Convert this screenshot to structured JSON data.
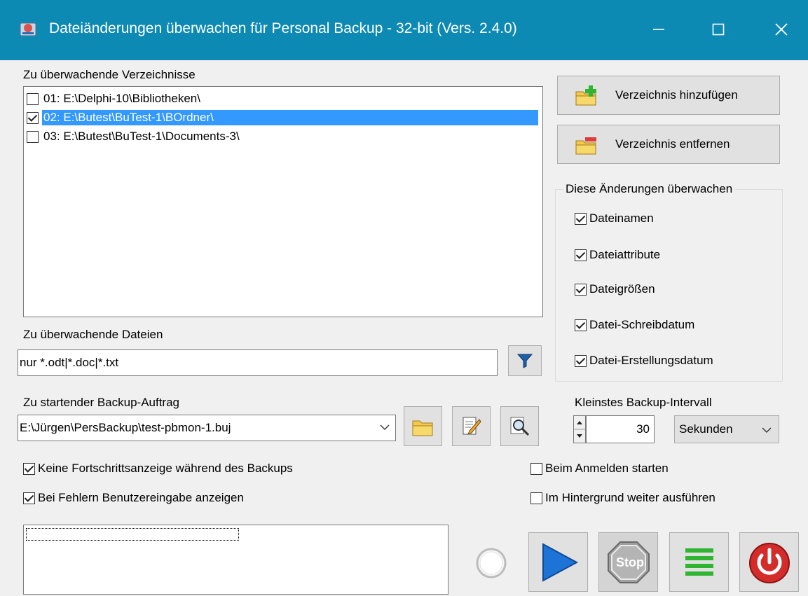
{
  "window": {
    "title": "Dateiänderungen überwachen für Personal Backup - 32-bit (Vers. 2.4.0)",
    "controls": [
      "minimize-icon",
      "maximize-icon",
      "close-icon"
    ]
  },
  "directories": {
    "label": "Zu überwachende Verzeichnisse",
    "items": [
      {
        "text": "01: E:\\Delphi-10\\Bibliotheken\\",
        "checked": false,
        "selected": false
      },
      {
        "text": "02: E:\\Butest\\BuTest-1\\BOrdner\\",
        "checked": true,
        "selected": true
      },
      {
        "text": "03: E:\\Butest\\BuTest-1\\Documents-3\\",
        "checked": false,
        "selected": false
      }
    ],
    "add_button": "Verzeichnis hinzufügen",
    "remove_button": "Verzeichnis entfernen"
  },
  "changes": {
    "title": "Diese Änderungen überwachen",
    "options": [
      {
        "label": "Dateinamen",
        "checked": true
      },
      {
        "label": "Dateiattribute",
        "checked": true
      },
      {
        "label": "Dateigrößen",
        "checked": true
      },
      {
        "label": "Datei-Schreibdatum",
        "checked": true
      },
      {
        "label": "Datei-Erstellungsdatum",
        "checked": true
      }
    ]
  },
  "files": {
    "label": "Zu überwachende Dateien",
    "value": "nur *.odt|*.doc|*.txt"
  },
  "job": {
    "label": "Zu startender Backup-Auftrag",
    "value": "E:\\Jürgen\\PersBackup\\test-pbmon-1.buj"
  },
  "interval": {
    "label": "Kleinstes Backup-Intervall",
    "value": "30",
    "unit": "Sekunden"
  },
  "options": {
    "no_progress": {
      "label": "Keine Fortschrittsanzeige während des Backups",
      "checked": true
    },
    "show_errors": {
      "label": "Bei Fehlern Benutzereingabe anzeigen",
      "checked": true
    },
    "start_on_login": {
      "label": "Beim Anmelden starten",
      "checked": false
    },
    "background": {
      "label": "Im Hintergrund weiter ausführen",
      "checked": false
    }
  },
  "actions": {
    "stop_label": "Stop"
  },
  "colors": {
    "titlebar": "#0d8ab4",
    "selection": "#3399ff",
    "play": "#1e73d6",
    "power": "#d42b2b",
    "green": "#2fb52f"
  }
}
